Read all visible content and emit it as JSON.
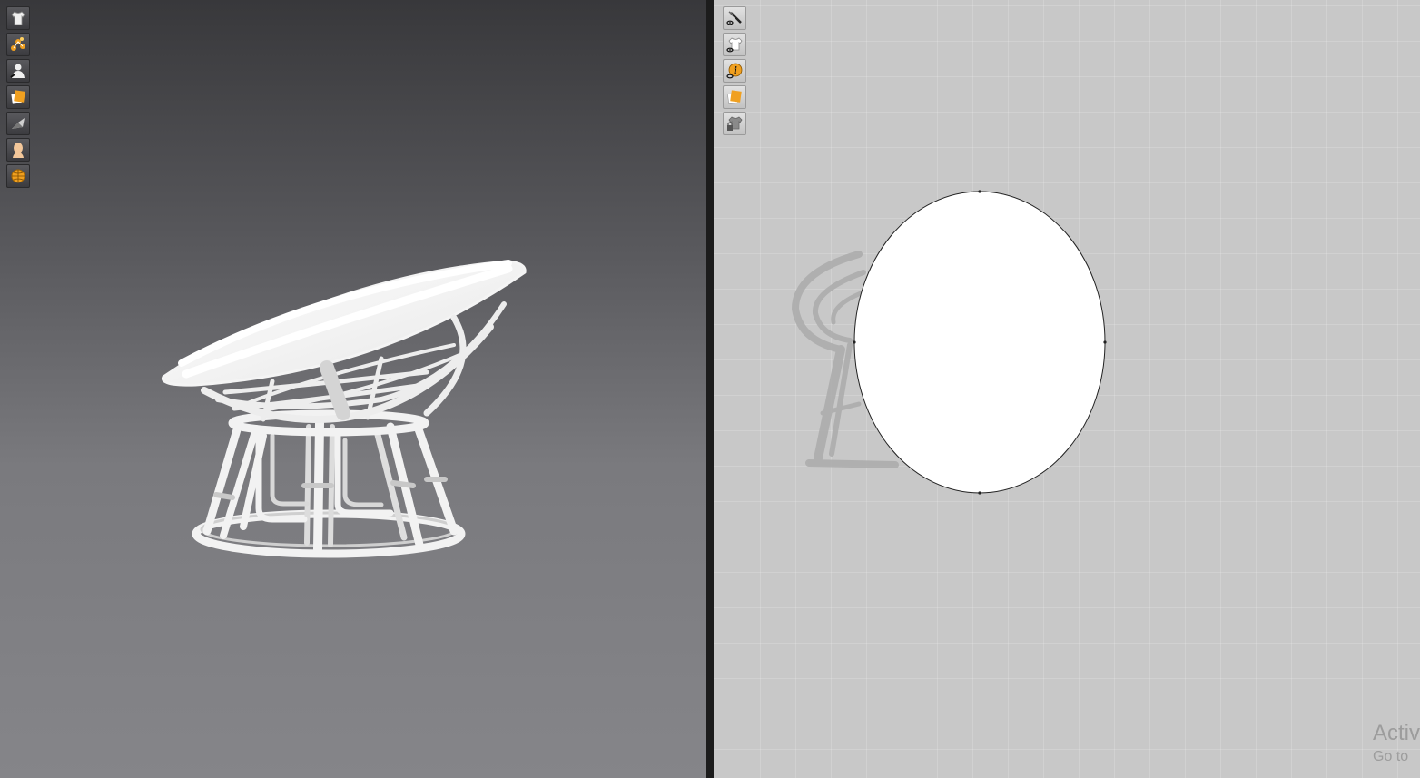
{
  "toolbar_3d": {
    "items": [
      {
        "icon": "garment-icon"
      },
      {
        "icon": "simulation-points-icon"
      },
      {
        "icon": "avatar-display-icon"
      },
      {
        "icon": "texture-icon"
      },
      {
        "icon": "render-quality-icon"
      },
      {
        "icon": "avatar-skin-icon"
      },
      {
        "icon": "environment-globe-icon"
      }
    ]
  },
  "toolbar_2d": {
    "items": [
      {
        "icon": "show-seams-icon"
      },
      {
        "icon": "show-garment-icon"
      },
      {
        "icon": "pattern-info-icon"
      },
      {
        "icon": "texture-2d-icon"
      },
      {
        "icon": "garment-lock-icon"
      }
    ]
  },
  "watermark": {
    "line1": "Activ",
    "line2": "Go to"
  },
  "colors": {
    "viewport_top": "#38383b",
    "viewport_bottom": "#858589",
    "pattern_bg": "#c8c8c8",
    "pattern_fill": "#ffffff",
    "accent_orange": "#f0a020"
  }
}
